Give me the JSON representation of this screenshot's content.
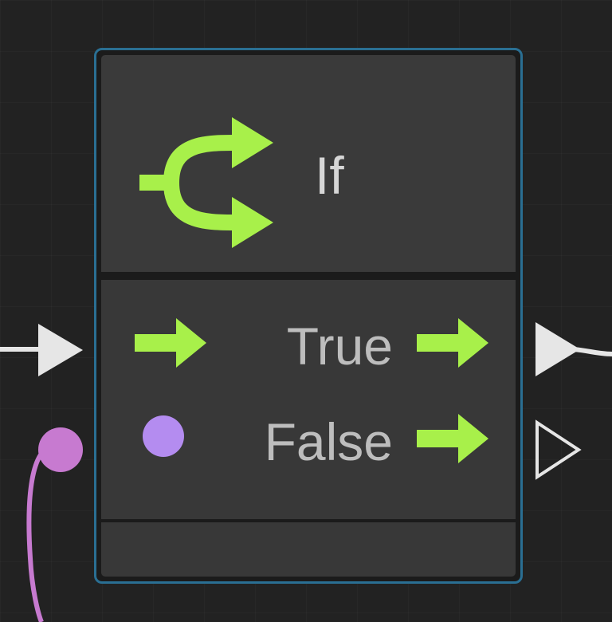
{
  "node": {
    "title": "If",
    "icon": "branch-icon",
    "rows": [
      {
        "label": "True",
        "input": "exec-arrow-icon",
        "output": "exec-arrow-icon"
      },
      {
        "label": "False",
        "input": "bool-dot-icon",
        "output": "exec-arrow-icon"
      }
    ]
  },
  "colors": {
    "accent_green": "#a8f04a",
    "node_border": "#2a6f93",
    "bool_pin": "#b48cf0",
    "data_wire": "#c77ad0",
    "exec_wire": "#e6e6e6"
  }
}
